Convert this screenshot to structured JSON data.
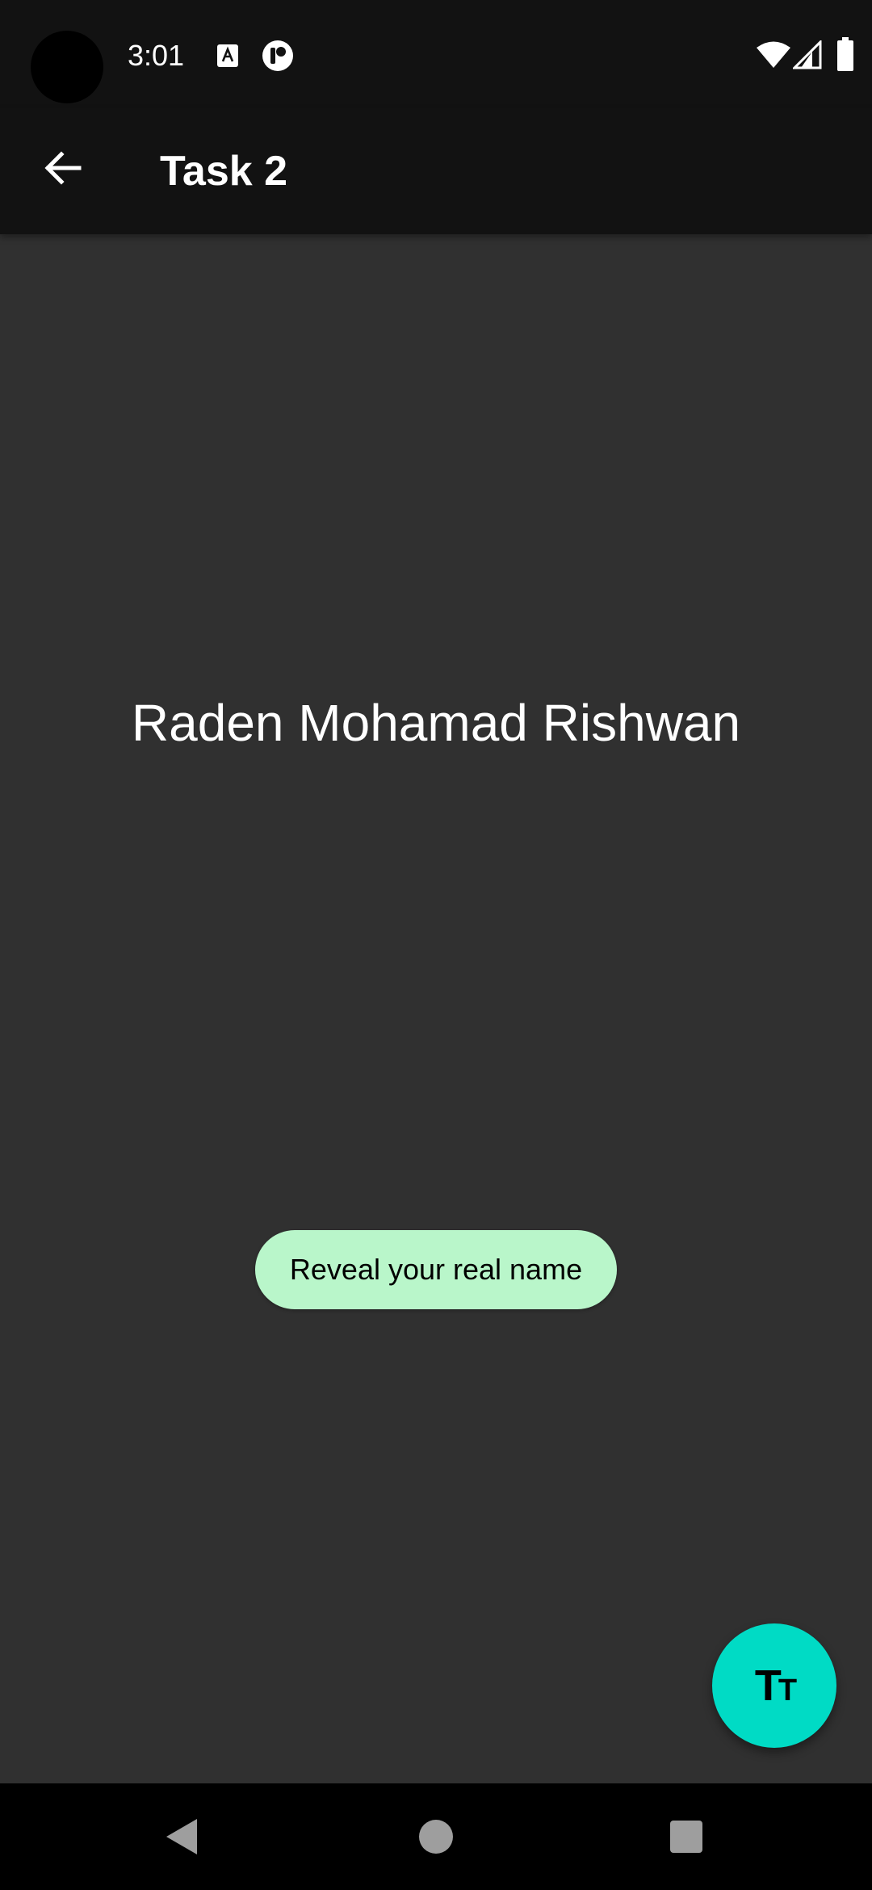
{
  "status_bar": {
    "time": "3:01",
    "icons": [
      "camera-cutout",
      "a-notification-icon",
      "record-notification-icon",
      "wifi-icon",
      "signal-icon",
      "battery-icon"
    ]
  },
  "app_bar": {
    "title": "Task 2",
    "back_icon": "arrow-back-icon"
  },
  "content": {
    "name": "Raden Mohamad Rishwan",
    "reveal_button_label": "Reveal your real name"
  },
  "fab": {
    "icon": "text-size-icon",
    "glyph_big": "T",
    "glyph_small": "T"
  },
  "nav_bar": {
    "icons": [
      "nav-back-icon",
      "nav-home-icon",
      "nav-recents-icon"
    ]
  },
  "colors": {
    "background": "#303030",
    "bar": "#121212",
    "reveal_button": "#b9f6ca",
    "fab": "#00dbc5"
  }
}
